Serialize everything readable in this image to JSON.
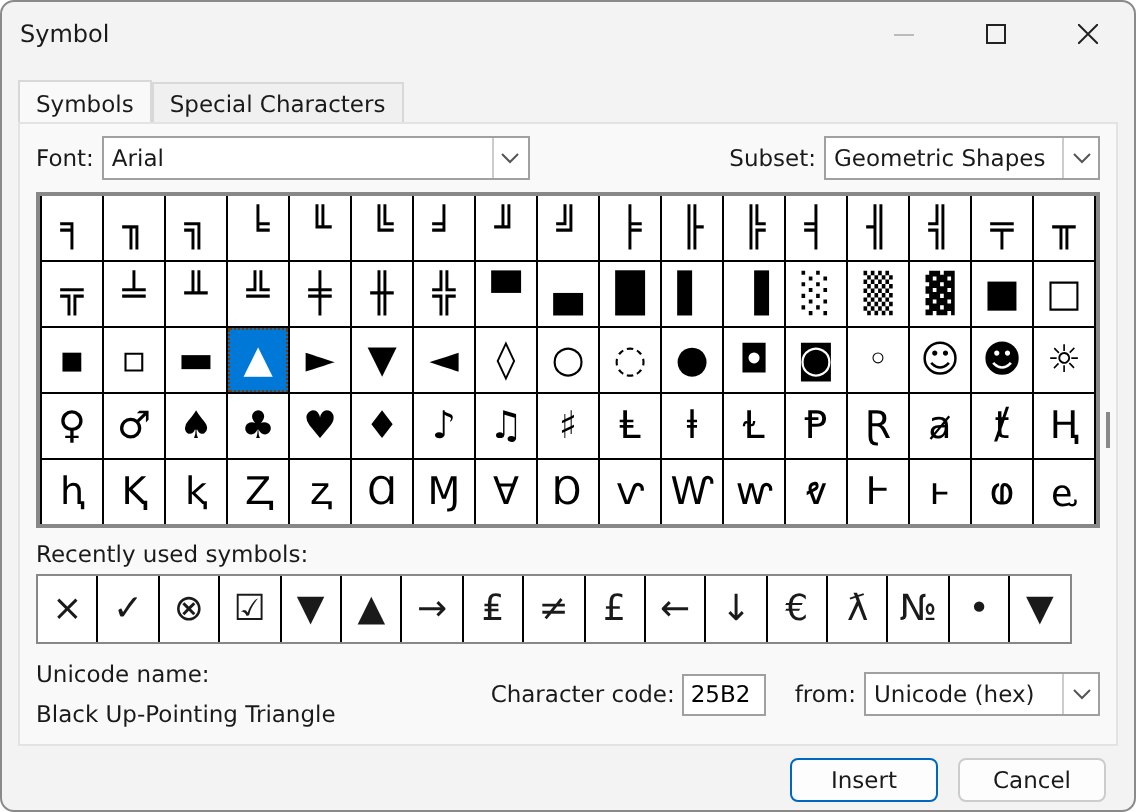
{
  "window": {
    "title": "Symbol"
  },
  "tabs": [
    {
      "label": "Symbols",
      "selected": true
    },
    {
      "label": "Special Characters",
      "selected": false
    }
  ],
  "font": {
    "label": "Font:",
    "value": "Arial"
  },
  "subset": {
    "label": "Subset:",
    "value": "Geometric Shapes"
  },
  "grid": {
    "rows": [
      [
        {
          "char": "╕",
          "selected": false
        },
        {
          "char": "╖",
          "selected": false
        },
        {
          "char": "╗",
          "selected": false
        },
        {
          "char": "╘",
          "selected": false
        },
        {
          "char": "╙",
          "selected": false
        },
        {
          "char": "╚",
          "selected": false
        },
        {
          "char": "╛",
          "selected": false
        },
        {
          "char": "╜",
          "selected": false
        },
        {
          "char": "╝",
          "selected": false
        },
        {
          "char": "╞",
          "selected": false
        },
        {
          "char": "╟",
          "selected": false
        },
        {
          "char": "╠",
          "selected": false
        },
        {
          "char": "╡",
          "selected": false
        },
        {
          "char": "╢",
          "selected": false
        },
        {
          "char": "╣",
          "selected": false
        },
        {
          "char": "╤",
          "selected": false
        },
        {
          "char": "╥",
          "selected": false
        }
      ],
      [
        {
          "char": "╦",
          "selected": false
        },
        {
          "char": "╧",
          "selected": false
        },
        {
          "char": "╨",
          "selected": false
        },
        {
          "char": "╩",
          "selected": false
        },
        {
          "char": "╪",
          "selected": false
        },
        {
          "char": "╫",
          "selected": false
        },
        {
          "char": "╬",
          "selected": false
        },
        {
          "char": "▀",
          "selected": false
        },
        {
          "char": "▄",
          "selected": false
        },
        {
          "char": "█",
          "selected": false
        },
        {
          "char": "▌",
          "selected": false
        },
        {
          "char": "▐",
          "selected": false
        },
        {
          "char": "░",
          "selected": false
        },
        {
          "char": "▒",
          "selected": false
        },
        {
          "char": "▓",
          "selected": false
        },
        {
          "char": "■",
          "selected": false
        },
        {
          "char": "□",
          "selected": false
        }
      ],
      [
        {
          "char": "▪",
          "selected": false
        },
        {
          "char": "▫",
          "selected": false
        },
        {
          "char": "▬",
          "selected": false
        },
        {
          "char": "▲",
          "selected": true
        },
        {
          "char": "►",
          "selected": false
        },
        {
          "char": "▼",
          "selected": false
        },
        {
          "char": "◄",
          "selected": false
        },
        {
          "char": "◊",
          "selected": false
        },
        {
          "char": "○",
          "selected": false
        },
        {
          "char": "◌",
          "selected": false
        },
        {
          "char": "●",
          "selected": false
        },
        {
          "char": "◘",
          "selected": false
        },
        {
          "char": "◙",
          "selected": false
        },
        {
          "char": "◦",
          "selected": false
        },
        {
          "char": "☺",
          "selected": false
        },
        {
          "char": "☻",
          "selected": false
        },
        {
          "char": "☼",
          "selected": false
        }
      ],
      [
        {
          "char": "♀",
          "selected": false
        },
        {
          "char": "♂",
          "selected": false
        },
        {
          "char": "♠",
          "selected": false
        },
        {
          "char": "♣",
          "selected": false
        },
        {
          "char": "♥",
          "selected": false
        },
        {
          "char": "♦",
          "selected": false
        },
        {
          "char": "♪",
          "selected": false
        },
        {
          "char": "♫",
          "selected": false
        },
        {
          "char": "♯",
          "selected": false
        },
        {
          "char": "Ⱡ",
          "selected": false
        },
        {
          "char": "ⱡ",
          "selected": false
        },
        {
          "char": "Ɫ",
          "selected": false
        },
        {
          "char": "Ᵽ",
          "selected": false
        },
        {
          "char": "Ɽ",
          "selected": false
        },
        {
          "char": "ⱥ",
          "selected": false
        },
        {
          "char": "ⱦ",
          "selected": false
        },
        {
          "char": "Ⱨ",
          "selected": false
        }
      ],
      [
        {
          "char": "ⱨ",
          "selected": false
        },
        {
          "char": "Ⱪ",
          "selected": false
        },
        {
          "char": "ⱪ",
          "selected": false
        },
        {
          "char": "Ⱬ",
          "selected": false
        },
        {
          "char": "ⱬ",
          "selected": false
        },
        {
          "char": "Ɑ",
          "selected": false
        },
        {
          "char": "Ɱ",
          "selected": false
        },
        {
          "char": "Ɐ",
          "selected": false
        },
        {
          "char": "Ɒ",
          "selected": false
        },
        {
          "char": "ⱱ",
          "selected": false
        },
        {
          "char": "Ⱳ",
          "selected": false
        },
        {
          "char": "ⱳ",
          "selected": false
        },
        {
          "char": "ⱴ",
          "selected": false
        },
        {
          "char": "Ⱶ",
          "selected": false
        },
        {
          "char": "ⱶ",
          "selected": false
        },
        {
          "char": "ⱷ",
          "selected": false
        },
        {
          "char": "ⱸ",
          "selected": false
        }
      ]
    ]
  },
  "recent": {
    "label": "Recently used symbols:",
    "symbols": [
      "×",
      "✓",
      "⊗",
      "☑",
      "▼",
      "▲",
      "→",
      "₤",
      "≠",
      "£",
      "←",
      "↓",
      "€",
      "ƛ",
      "№",
      "•",
      "▼"
    ]
  },
  "unicode_name": {
    "label": "Unicode name:",
    "value": "Black Up-Pointing Triangle"
  },
  "character_code": {
    "label": "Character code:",
    "value": "25B2"
  },
  "from": {
    "label": "from:",
    "value": "Unicode (hex)"
  },
  "buttons": [
    {
      "label": "Insert",
      "default": true
    },
    {
      "label": "Cancel",
      "default": false
    }
  ]
}
